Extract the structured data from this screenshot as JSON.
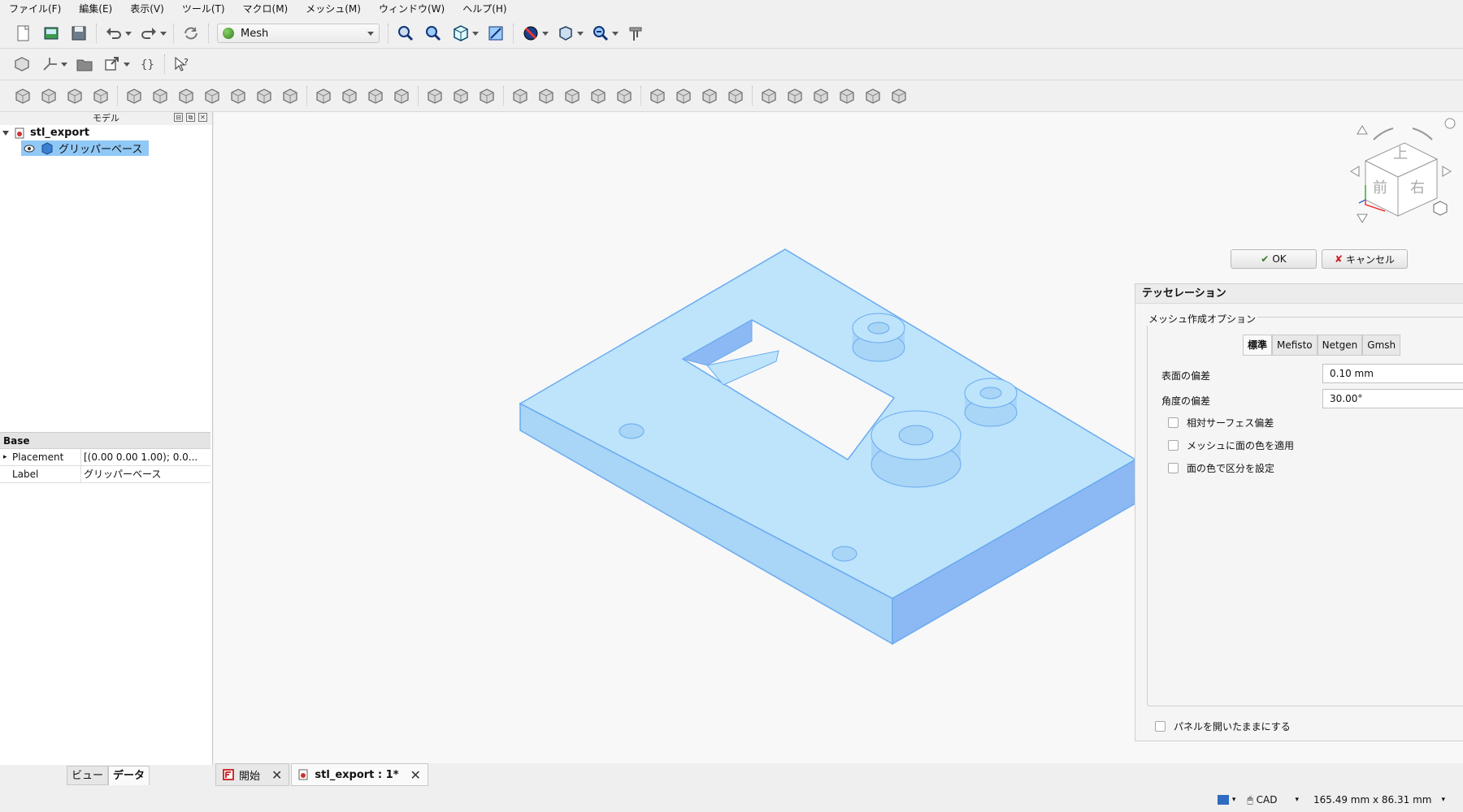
{
  "menubar": [
    {
      "label": "ファイル(F)"
    },
    {
      "label": "編集(E)"
    },
    {
      "label": "表示(V)"
    },
    {
      "label": "ツール(T)"
    },
    {
      "label": "マクロ(M)"
    },
    {
      "label": "メッシュ(M)"
    },
    {
      "label": "ウィンドウ(W)"
    },
    {
      "label": "ヘルプ(H)"
    }
  ],
  "toolbar": {
    "workbench": "Mesh"
  },
  "model_panel": {
    "title": "モデル",
    "doc_name": "stl_export",
    "item_label": "グリッパーベース"
  },
  "properties": {
    "group": "Base",
    "rows": [
      {
        "key": "Placement",
        "value": "[(0.00 0.00 1.00); 0.0..."
      },
      {
        "key": "Label",
        "value": "グリッパーベース"
      }
    ]
  },
  "bottom_tabs": {
    "view": "ビュー",
    "data": "データ"
  },
  "doc_tabs": [
    {
      "label": "開始"
    },
    {
      "label": "stl_export : 1*"
    }
  ],
  "navcube": {
    "top": "上",
    "front": "前",
    "right": "右"
  },
  "task": {
    "ok": "OK",
    "cancel": "キャンセル",
    "title": "テッセレーション",
    "group": "メッシュ作成オプション",
    "tabs": [
      "標準",
      "Mefisto",
      "Netgen",
      "Gmsh"
    ],
    "surface_label": "表面の偏差",
    "surface_value": "0.10 mm",
    "angle_label": "角度の偏差",
    "angle_value": "30.00°",
    "checkboxes": [
      "相対サーフェス偏差",
      "メッシュに面の色を適用",
      "面の色で区分を設定"
    ],
    "keep_open": "パネルを開いたままにする"
  },
  "status": {
    "mode": "CAD",
    "dims": "165.49 mm x 86.31 mm"
  },
  "colors": {
    "mesh_fill": "#bde4fb",
    "mesh_edge": "#6aaaf0",
    "selection": "#90c8f6"
  }
}
